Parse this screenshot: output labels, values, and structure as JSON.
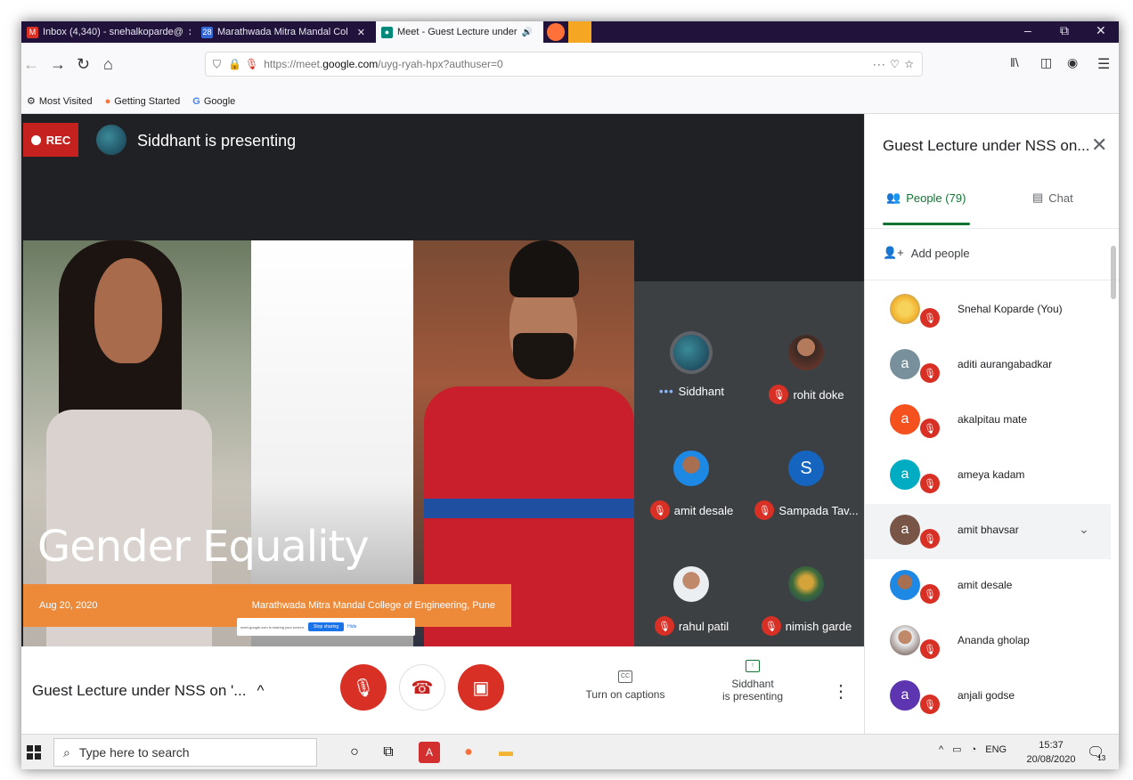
{
  "browser": {
    "tabs": [
      {
        "label": "Inbox (4,340) - snehalkoparde@",
        "close": "✕",
        "fav_color": "#d93025",
        "fav_glyph": "M"
      },
      {
        "label": "Marathwada Mitra Mandal Col",
        "close": "✕",
        "fav_color": "#3367d6",
        "fav_glyph": "28"
      },
      {
        "label": "Meet - Guest Lecture under",
        "close": "✕",
        "fav_color": "#00897b",
        "fav_glyph": "●"
      }
    ],
    "window_controls": {
      "minimize": "–",
      "restore": "⧉",
      "close": "✕"
    },
    "url": {
      "prefix": "https://meet.",
      "host": "google.com",
      "path": "/uyg-ryah-hpx?authuser=0"
    },
    "bookmarks": [
      {
        "label": "Most Visited",
        "icon": "gear-icon"
      },
      {
        "label": "Getting Started",
        "icon": "firefox-icon"
      },
      {
        "label": "Google",
        "icon": "google-icon"
      }
    ]
  },
  "meet": {
    "rec_label": "REC",
    "presenting_text": "Siddhant is presenting",
    "slide": {
      "title": "Gender Equality",
      "date": "Aug 20, 2020",
      "org": "Marathwada Mitra Mandal College of Engineering, Pune",
      "share_notice": "meet.google.com is sharing your screen.",
      "stop_sharing": "Stop sharing",
      "hide": "Hide"
    },
    "tiles": [
      {
        "name": "Siddhant",
        "avatar_color": "#1f4a5c",
        "avatar_letter": "",
        "speaking": true
      },
      {
        "name": "rohit doke",
        "avatar_color": "#7a3b2e",
        "avatar_letter": ""
      },
      {
        "name": "amit desale",
        "avatar_color": "#1e88e5",
        "avatar_letter": ""
      },
      {
        "name": "Sampada Tav...",
        "avatar_color": "#1565c0",
        "avatar_letter": "S"
      },
      {
        "name": "rahul patil",
        "avatar_color": "#cfd8dc",
        "avatar_letter": ""
      },
      {
        "name": "nimish garde",
        "avatar_color": "#3f6b3a",
        "avatar_letter": ""
      }
    ],
    "controls": {
      "meeting_title": "Guest Lecture under NSS on '...",
      "caret": "^",
      "captions_label": "Turn on captions",
      "presenting_line1": "Siddhant",
      "presenting_line2": "is presenting",
      "more": "⋮"
    }
  },
  "panel": {
    "title": "Guest Lecture under NSS on...",
    "close": "✕",
    "people_tab": "People (79)",
    "chat_tab": "Chat",
    "add_people": "Add people",
    "people": [
      {
        "name": "Snehal Koparde (You)",
        "letter": "",
        "color": "#f2b330"
      },
      {
        "name": "aditi aurangabadkar",
        "letter": "a",
        "color": "#78909c"
      },
      {
        "name": "akalpitau mate",
        "letter": "a",
        "color": "#f4511e"
      },
      {
        "name": "ameya kadam",
        "letter": "a",
        "color": "#00acc1"
      },
      {
        "name": "amit bhavsar",
        "letter": "a",
        "color": "#795548"
      },
      {
        "name": "amit desale",
        "letter": "",
        "color": "#1e88e5"
      },
      {
        "name": "Ananda gholap",
        "letter": "",
        "color": "#5d4037"
      },
      {
        "name": "anjali godse",
        "letter": "a",
        "color": "#5e35b1"
      }
    ]
  },
  "taskbar": {
    "search_placeholder": "Type here to search",
    "lang": "ENG",
    "time": "15:37",
    "date": "20/08/2020",
    "notif_count": "13"
  }
}
